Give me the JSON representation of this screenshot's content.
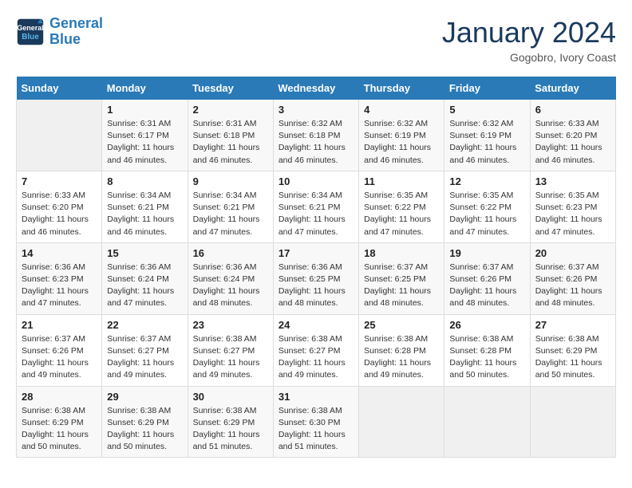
{
  "header": {
    "logo_line1": "General",
    "logo_line2": "Blue",
    "month": "January 2024",
    "location": "Gogobro, Ivory Coast"
  },
  "weekdays": [
    "Sunday",
    "Monday",
    "Tuesday",
    "Wednesday",
    "Thursday",
    "Friday",
    "Saturday"
  ],
  "weeks": [
    [
      {
        "day": "",
        "info": ""
      },
      {
        "day": "1",
        "info": "Sunrise: 6:31 AM\nSunset: 6:17 PM\nDaylight: 11 hours\nand 46 minutes."
      },
      {
        "day": "2",
        "info": "Sunrise: 6:31 AM\nSunset: 6:18 PM\nDaylight: 11 hours\nand 46 minutes."
      },
      {
        "day": "3",
        "info": "Sunrise: 6:32 AM\nSunset: 6:18 PM\nDaylight: 11 hours\nand 46 minutes."
      },
      {
        "day": "4",
        "info": "Sunrise: 6:32 AM\nSunset: 6:19 PM\nDaylight: 11 hours\nand 46 minutes."
      },
      {
        "day": "5",
        "info": "Sunrise: 6:32 AM\nSunset: 6:19 PM\nDaylight: 11 hours\nand 46 minutes."
      },
      {
        "day": "6",
        "info": "Sunrise: 6:33 AM\nSunset: 6:20 PM\nDaylight: 11 hours\nand 46 minutes."
      }
    ],
    [
      {
        "day": "7",
        "info": "Sunrise: 6:33 AM\nSunset: 6:20 PM\nDaylight: 11 hours\nand 46 minutes."
      },
      {
        "day": "8",
        "info": "Sunrise: 6:34 AM\nSunset: 6:21 PM\nDaylight: 11 hours\nand 46 minutes."
      },
      {
        "day": "9",
        "info": "Sunrise: 6:34 AM\nSunset: 6:21 PM\nDaylight: 11 hours\nand 47 minutes."
      },
      {
        "day": "10",
        "info": "Sunrise: 6:34 AM\nSunset: 6:21 PM\nDaylight: 11 hours\nand 47 minutes."
      },
      {
        "day": "11",
        "info": "Sunrise: 6:35 AM\nSunset: 6:22 PM\nDaylight: 11 hours\nand 47 minutes."
      },
      {
        "day": "12",
        "info": "Sunrise: 6:35 AM\nSunset: 6:22 PM\nDaylight: 11 hours\nand 47 minutes."
      },
      {
        "day": "13",
        "info": "Sunrise: 6:35 AM\nSunset: 6:23 PM\nDaylight: 11 hours\nand 47 minutes."
      }
    ],
    [
      {
        "day": "14",
        "info": "Sunrise: 6:36 AM\nSunset: 6:23 PM\nDaylight: 11 hours\nand 47 minutes."
      },
      {
        "day": "15",
        "info": "Sunrise: 6:36 AM\nSunset: 6:24 PM\nDaylight: 11 hours\nand 47 minutes."
      },
      {
        "day": "16",
        "info": "Sunrise: 6:36 AM\nSunset: 6:24 PM\nDaylight: 11 hours\nand 48 minutes."
      },
      {
        "day": "17",
        "info": "Sunrise: 6:36 AM\nSunset: 6:25 PM\nDaylight: 11 hours\nand 48 minutes."
      },
      {
        "day": "18",
        "info": "Sunrise: 6:37 AM\nSunset: 6:25 PM\nDaylight: 11 hours\nand 48 minutes."
      },
      {
        "day": "19",
        "info": "Sunrise: 6:37 AM\nSunset: 6:26 PM\nDaylight: 11 hours\nand 48 minutes."
      },
      {
        "day": "20",
        "info": "Sunrise: 6:37 AM\nSunset: 6:26 PM\nDaylight: 11 hours\nand 48 minutes."
      }
    ],
    [
      {
        "day": "21",
        "info": "Sunrise: 6:37 AM\nSunset: 6:26 PM\nDaylight: 11 hours\nand 49 minutes."
      },
      {
        "day": "22",
        "info": "Sunrise: 6:37 AM\nSunset: 6:27 PM\nDaylight: 11 hours\nand 49 minutes."
      },
      {
        "day": "23",
        "info": "Sunrise: 6:38 AM\nSunset: 6:27 PM\nDaylight: 11 hours\nand 49 minutes."
      },
      {
        "day": "24",
        "info": "Sunrise: 6:38 AM\nSunset: 6:27 PM\nDaylight: 11 hours\nand 49 minutes."
      },
      {
        "day": "25",
        "info": "Sunrise: 6:38 AM\nSunset: 6:28 PM\nDaylight: 11 hours\nand 49 minutes."
      },
      {
        "day": "26",
        "info": "Sunrise: 6:38 AM\nSunset: 6:28 PM\nDaylight: 11 hours\nand 50 minutes."
      },
      {
        "day": "27",
        "info": "Sunrise: 6:38 AM\nSunset: 6:29 PM\nDaylight: 11 hours\nand 50 minutes."
      }
    ],
    [
      {
        "day": "28",
        "info": "Sunrise: 6:38 AM\nSunset: 6:29 PM\nDaylight: 11 hours\nand 50 minutes."
      },
      {
        "day": "29",
        "info": "Sunrise: 6:38 AM\nSunset: 6:29 PM\nDaylight: 11 hours\nand 50 minutes."
      },
      {
        "day": "30",
        "info": "Sunrise: 6:38 AM\nSunset: 6:29 PM\nDaylight: 11 hours\nand 51 minutes."
      },
      {
        "day": "31",
        "info": "Sunrise: 6:38 AM\nSunset: 6:30 PM\nDaylight: 11 hours\nand 51 minutes."
      },
      {
        "day": "",
        "info": ""
      },
      {
        "day": "",
        "info": ""
      },
      {
        "day": "",
        "info": ""
      }
    ]
  ]
}
